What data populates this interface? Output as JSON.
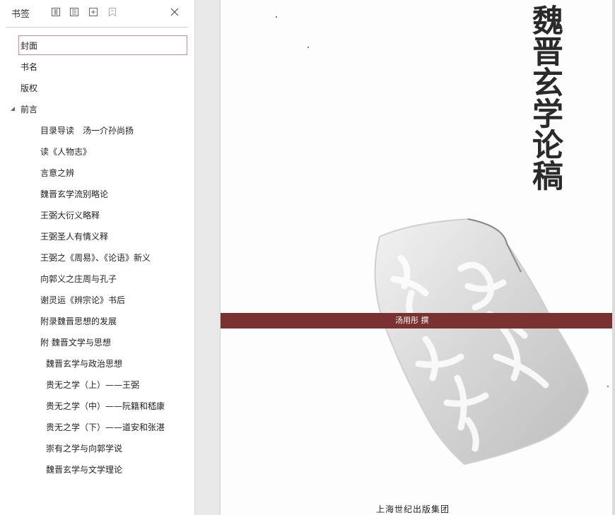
{
  "sidebar": {
    "title": "书签",
    "toolbar_icons": [
      "expand-all-icon",
      "collapse-all-icon",
      "add-bookmark-icon",
      "bookmark-icon"
    ],
    "items": [
      {
        "label": "封面",
        "level": 0,
        "selected": true
      },
      {
        "label": "书名",
        "level": 0
      },
      {
        "label": "版权",
        "level": 0
      },
      {
        "label": "前言",
        "level": 0,
        "expanded": true
      },
      {
        "label": "目录导读　汤一介孙尚扬",
        "level": 1
      },
      {
        "label": "读《人物志》",
        "level": 1
      },
      {
        "label": "言意之辨",
        "level": 1
      },
      {
        "label": "魏晋玄学流别略论",
        "level": 1
      },
      {
        "label": "王弼大衍义略释",
        "level": 1
      },
      {
        "label": "王弼圣人有情义释",
        "level": 1
      },
      {
        "label": "王弼之《周易》、《论语》新义",
        "level": 1
      },
      {
        "label": "向郭义之庄周与孔子",
        "level": 1
      },
      {
        "label": "谢灵运《辨宗论》书后",
        "level": 1
      },
      {
        "label": "附录魏晋思想的发展",
        "level": 1
      },
      {
        "label": "附 魏晋文学与思想",
        "level": 1
      },
      {
        "label": "魏晋玄学与政治思想",
        "level": 2
      },
      {
        "label": "贵无之学（上）——王弼",
        "level": 2
      },
      {
        "label": "贵无之学（中）——阮籍和嵇康",
        "level": 2
      },
      {
        "label": "贵无之学（下）——道安和张湛",
        "level": 2
      },
      {
        "label": "崇有之学与向郭学说",
        "level": 2
      },
      {
        "label": "魏晋玄学与文学理论",
        "level": 2
      }
    ]
  },
  "page": {
    "book_title": "魏晋玄学论稿",
    "author": "汤用彤 撰",
    "publisher": "上海世纪出版集团"
  },
  "colors": {
    "band": "#7a3230",
    "selection_border": "#d9878f"
  }
}
